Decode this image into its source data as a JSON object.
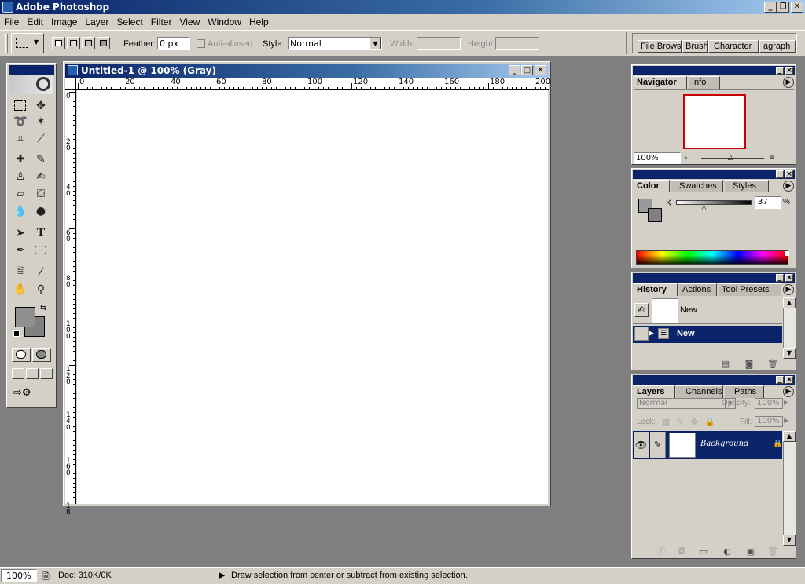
{
  "window": {
    "title": "Adobe Photoshop"
  },
  "menu": [
    "File",
    "Edit",
    "Image",
    "Layer",
    "Select",
    "Filter",
    "View",
    "Window",
    "Help"
  ],
  "options": {
    "feather_label": "Feather:",
    "feather_value": "0 px",
    "antialias_label": "Anti-aliased",
    "style_label": "Style:",
    "style_value": "Normal",
    "width_label": "Width:",
    "height_label": "Height:"
  },
  "palette_well": {
    "tabs": [
      "File Brows",
      "Brush",
      "Character",
      "agraph"
    ]
  },
  "document": {
    "title": "Untitled-1 @ 100% (Gray)",
    "ruler_top": [
      "0",
      "20",
      "40",
      "60",
      "80",
      "100",
      "120",
      "140",
      "160",
      "180",
      "200"
    ],
    "ruler_left": [
      "0",
      "2\n0",
      "4\n0",
      "6\n0",
      "8\n0",
      "1\n0\n0",
      "1\n2\n0",
      "1\n4\n0",
      "1\n6\n0",
      "1\n8"
    ]
  },
  "navigator": {
    "tabs": [
      "Navigator",
      "Info"
    ],
    "zoom": "100%"
  },
  "color": {
    "tabs": [
      "Color",
      "Swatches",
      "Styles"
    ],
    "channel": "K",
    "value": "37",
    "unit": "%"
  },
  "history": {
    "tabs": [
      "History",
      "Actions",
      "Tool Presets"
    ],
    "snapshot_label": "New",
    "state_label": "New"
  },
  "layers": {
    "tabs": [
      "Layers",
      "Channels",
      "Paths"
    ],
    "blend_mode": "Normal",
    "opacity_label": "Opacity:",
    "opacity_value": "100%",
    "lock_label": "Lock:",
    "fill_label": "Fill:",
    "fill_value": "100%",
    "layer_name": "Background"
  },
  "status": {
    "zoom": "100%",
    "doc": "Doc: 310K/0K",
    "hint": "Draw selection from center or subtract from existing selection."
  },
  "colors": {
    "titlebar": "#0a246a",
    "chrome": "#d4d0c8",
    "workspace": "#808080",
    "selection": "#0a246a"
  }
}
